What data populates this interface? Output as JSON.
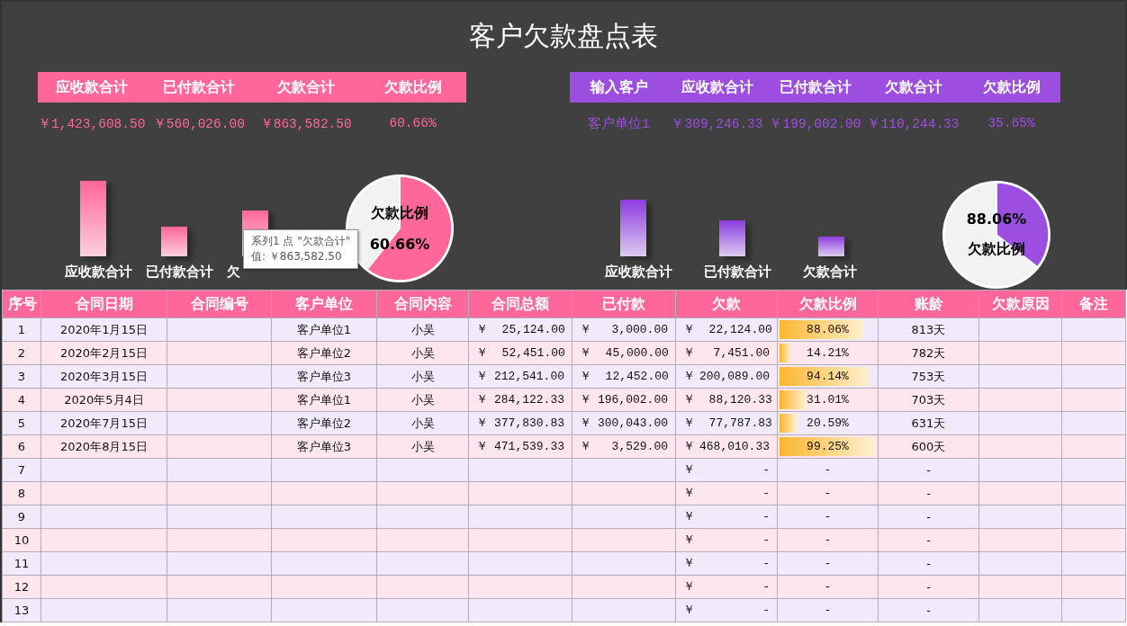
{
  "title": "客户欠款盘点表",
  "totals_panel": {
    "headers": [
      "应收款合计",
      "已付款合计",
      "欠款合计",
      "欠款比例"
    ],
    "values": [
      "￥1,423,608.50",
      "￥560,026.00",
      "￥863,582.50",
      "60.66%"
    ],
    "bars": [
      {
        "label": "应收款合计",
        "level": 0.84
      },
      {
        "label": "已付款合计",
        "level": 0.33
      },
      {
        "label": "欠",
        "level": 0.51
      }
    ],
    "pie": {
      "chart_data": {
        "type": "pie",
        "values": [
          60.66,
          39.34
        ]
      },
      "labels": [
        "欠款比例",
        "60.66%"
      ]
    },
    "tooltip": {
      "lines": [
        "系列1 点 \"欠款合计\"",
        "值: ￥863,582.50"
      ]
    }
  },
  "customer_panel": {
    "headers": [
      "输入客户",
      "应收款合计",
      "已付款合计",
      "欠款合计",
      "欠款比例"
    ],
    "values": [
      "客户单位1",
      "￥309,246.33",
      "￥199,002.00",
      "￥110,244.33",
      "35.65%"
    ],
    "bars": [
      {
        "label": "应收款合计",
        "level": 0.63
      },
      {
        "label": "已付款合计",
        "level": 0.4
      },
      {
        "label": "欠款合计",
        "level": 0.22
      }
    ],
    "pie": {
      "chart_data": {
        "type": "pie",
        "values": [
          35.65,
          64.35
        ]
      },
      "labels": [
        "88.06%",
        "欠款比例"
      ]
    }
  },
  "table": {
    "columns": [
      "序号",
      "合同日期",
      "合同编号",
      "客户单位",
      "合同内容",
      "合同总额",
      "已付款",
      "欠款",
      "欠款比例",
      "账龄",
      "欠款原因",
      "备注"
    ],
    "rows": [
      {
        "no": "1",
        "date": "2020年1月15日",
        "customer": "客户单位1",
        "content": "小吴",
        "total": "￥ 25,124.00",
        "paid": "￥ 3,000.00",
        "owed": "￥ 22,124.00",
        "ratio": "88.06%",
        "level": 0.8806,
        "age": "813天"
      },
      {
        "no": "2",
        "date": "2020年2月15日",
        "customer": "客户单位2",
        "content": "小吴",
        "total": "￥ 52,451.00",
        "paid": "￥ 45,000.00",
        "owed": "￥ 7,451.00",
        "ratio": "14.21%",
        "level": 0.1421,
        "age": "782天"
      },
      {
        "no": "3",
        "date": "2020年3月15日",
        "customer": "客户单位3",
        "content": "小吴",
        "total": "￥212,541.00",
        "paid": "￥ 12,452.00",
        "owed": "￥200,089.00",
        "ratio": "94.14%",
        "level": 0.9414,
        "age": "753天"
      },
      {
        "no": "4",
        "date": "2020年5月4日",
        "customer": "客户单位1",
        "content": "小吴",
        "total": "￥284,122.33",
        "paid": "￥196,002.00",
        "owed": "￥ 88,120.33",
        "ratio": "31.01%",
        "level": 0.3101,
        "age": "703天"
      },
      {
        "no": "5",
        "date": "2020年7月15日",
        "customer": "客户单位2",
        "content": "小吴",
        "total": "￥377,830.83",
        "paid": "￥300,043.00",
        "owed": "￥ 77,787.83",
        "ratio": "20.59%",
        "level": 0.2059,
        "age": "631天"
      },
      {
        "no": "6",
        "date": "2020年8月15日",
        "customer": "客户单位3",
        "content": "小吴",
        "total": "￥471,539.33",
        "paid": "￥ 3,529.00",
        "owed": "￥468,010.33",
        "ratio": "99.25%",
        "level": 0.9925,
        "age": "600天"
      },
      {
        "no": "7",
        "owed": "￥ -",
        "ratio": "-",
        "age": "-"
      },
      {
        "no": "8",
        "owed": "￥ -",
        "ratio": "-",
        "age": "-"
      },
      {
        "no": "9",
        "owed": "￥ -",
        "ratio": "-",
        "age": "-"
      },
      {
        "no": "10",
        "owed": "￥ -",
        "ratio": "-",
        "age": "-"
      },
      {
        "no": "11",
        "owed": "￥ -",
        "ratio": "-",
        "age": "-"
      },
      {
        "no": "12",
        "owed": "￥ -",
        "ratio": "-",
        "age": "-"
      },
      {
        "no": "13",
        "owed": "￥ -",
        "ratio": "-",
        "age": "-"
      }
    ]
  }
}
